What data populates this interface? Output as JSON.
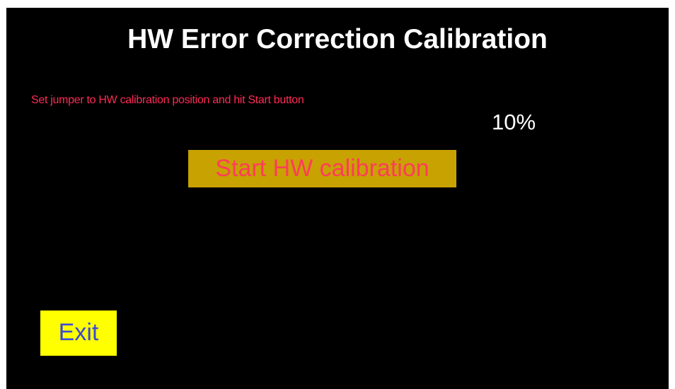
{
  "screen": {
    "title": "HW Error Correction Calibration",
    "instruction": "Set jumper to HW calibration position and hit Start button",
    "progress_text": "10%",
    "start_button_label": "Start HW calibration",
    "exit_button_label": "Exit"
  },
  "colors": {
    "background": "#000000",
    "title_text": "#ffffff",
    "instruction_text": "#ff2a55",
    "start_button_bg": "#c8a200",
    "start_button_text": "#ff3d5a",
    "exit_button_bg": "#ffff00",
    "exit_button_text": "#3c4bd6"
  }
}
